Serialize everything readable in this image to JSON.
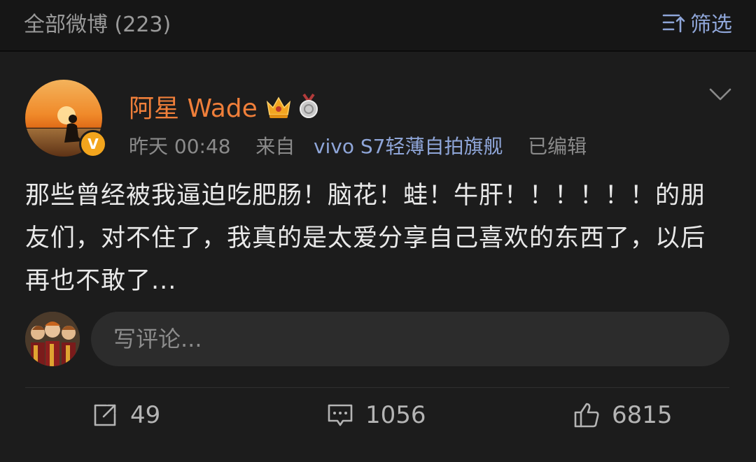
{
  "header": {
    "all_posts_label": "全部微博 (223)",
    "filter_label": "筛选"
  },
  "post": {
    "username": "阿星 Wade",
    "verified_badge": "V",
    "time": "昨天 00:48",
    "source_prefix": "来自",
    "device": "vivo S7轻薄自拍旗舰",
    "edited": "已编辑",
    "content": "那些曾经被我逼迫吃肥肠！脑花！蛙！牛肝！！！！！！的朋友们，对不住了，我真的是太爱分享自己喜欢的东西了，以后再也不敢了..."
  },
  "comment_box": {
    "placeholder": "写评论..."
  },
  "actions": {
    "reposts": "49",
    "comments": "1056",
    "likes": "6815"
  },
  "colors": {
    "accent_name": "#f07f3a",
    "link_blue": "#8fa6d9",
    "background": "#1c1c1c"
  },
  "icons": [
    "filter-icon",
    "crown-icon",
    "medal-icon",
    "chevron-down-icon",
    "share-icon",
    "comment-icon",
    "like-icon"
  ]
}
